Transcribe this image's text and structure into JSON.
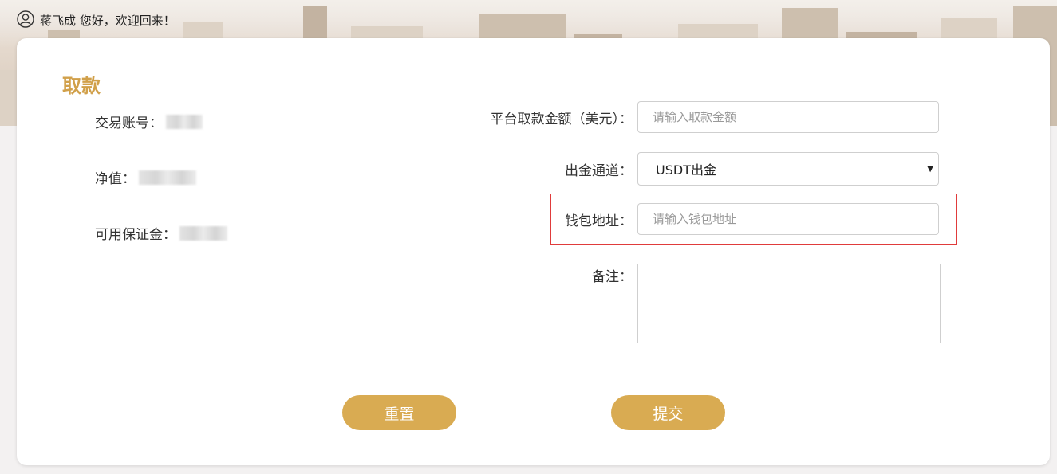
{
  "header": {
    "greeting": "蒋飞成 您好，欢迎回来！",
    "user_icon": "user-circle-icon"
  },
  "page": {
    "title": "取款"
  },
  "account_info": {
    "trading_account_label": "交易账号：",
    "net_value_label": "净值：",
    "available_margin_label": "可用保证金："
  },
  "form": {
    "amount_label": "平台取款金额（美元）：",
    "amount_placeholder": "请输入取款金额",
    "channel_label": "出金通道：",
    "channel_value": "USDT出金",
    "wallet_label": "钱包地址：",
    "wallet_placeholder": "请输入钱包地址",
    "remark_label": "备注："
  },
  "buttons": {
    "reset": "重置",
    "submit": "提交"
  },
  "colors": {
    "accent": "#d9ab52",
    "title": "#d1a04a",
    "highlight_border": "#e03b3b"
  }
}
